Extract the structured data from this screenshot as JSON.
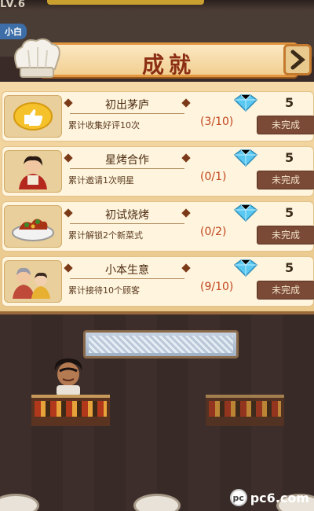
{
  "top": {
    "level_text": "LV.6",
    "player_name": "小白"
  },
  "header": {
    "title": "成就"
  },
  "achievements": [
    {
      "name": "初出茅庐",
      "desc": "累计收集好评10次",
      "progress": "(3/10)",
      "reward": "5",
      "status": "未完成",
      "thumb": "thumbs-up-icon"
    },
    {
      "name": "星烤合作",
      "desc": "累计邀请1次明星",
      "progress": "(0/1)",
      "reward": "5",
      "status": "未完成",
      "thumb": "star-portrait"
    },
    {
      "name": "初试烧烤",
      "desc": "累计解锁2个新菜式",
      "progress": "(0/2)",
      "reward": "5",
      "status": "未完成",
      "thumb": "bbq-plate"
    },
    {
      "name": "小本生意",
      "desc": "累计接待10个顾客",
      "progress": "(9/10)",
      "reward": "5",
      "status": "未完成",
      "thumb": "customers-portrait"
    }
  ],
  "watermark": {
    "logo": "pc",
    "text": "pc6.com"
  },
  "colors": {
    "accent": "#e2973e",
    "title": "#8b2e14",
    "progress": "#c0461f",
    "button": "#7a4a36",
    "gem": "#5ac8f0"
  }
}
